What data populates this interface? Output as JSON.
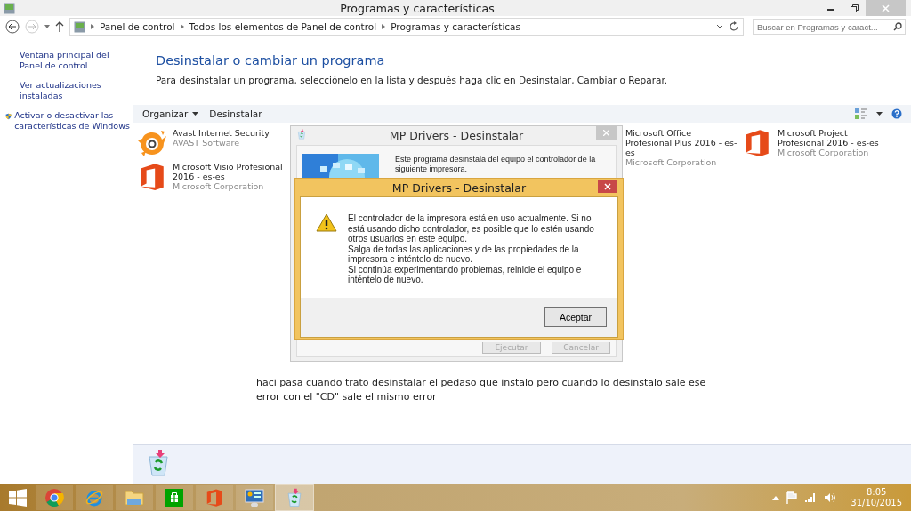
{
  "window": {
    "title": "Programas y características"
  },
  "address_bar": {
    "breadcrumbs": [
      "Panel de control",
      "Todos los elementos de Panel de control",
      "Programas y características"
    ]
  },
  "search": {
    "placeholder": "Buscar en Programas y caract..."
  },
  "sidebar": {
    "links": [
      {
        "label": "Ventana principal del Panel de control",
        "kind": "link"
      },
      {
        "label": "Ver actualizaciones instaladas",
        "kind": "link"
      },
      {
        "label": "Activar o desactivar las características de Windows",
        "kind": "shield"
      }
    ]
  },
  "heading": "Desinstalar o cambiar un programa",
  "description": "Para desinstalar un programa, selecciónelo en la lista y después haga clic en Desinstalar, Cambiar o Reparar.",
  "toolbar": {
    "buttons": [
      {
        "label": "Organizar",
        "kind": "menu"
      },
      {
        "label": "Desinstalar",
        "kind": "plain"
      }
    ]
  },
  "programs": [
    {
      "name": "Avast Internet Security",
      "publisher": "AVAST Software",
      "kind": "avast"
    },
    {
      "name": "Microsoft Office Profesional Plus 2016 - es-es",
      "publisher": "Microsoft Corporation",
      "kind": "covered"
    },
    {
      "name": "Microsoft Project Profesional 2016 - es-es",
      "publisher": "Microsoft Corporation",
      "kind": "office"
    },
    {
      "name": "Microsoft Visio Profesional 2016 - es-es",
      "publisher": "Microsoft Corporation",
      "kind": "office"
    }
  ],
  "caption": "haci pasa cuando trato desinstalar el pedaso que instalo pero cuando lo desinstalo sale ese error con el \"CD\" sale el mismo error",
  "background_dialog": {
    "title": "MP Drivers - Desinstalar",
    "text": "Este programa desinstala del equipo el controlador de la siguiente impresora.",
    "buttons": [
      {
        "label": "Ejecutar",
        "disabled": true
      },
      {
        "label": "Cancelar",
        "disabled": true
      }
    ]
  },
  "alert_dialog": {
    "title": "MP Drivers - Desinstalar",
    "paragraphs": [
      "El controlador de la impresora está en uso actualmente. Si no está usando dicho controlador, es posible que lo estén usando otros usuarios en este equipo.",
      "Salga de todas las aplicaciones y de las propiedades de la impresora e inténtelo de nuevo.",
      "Si continúa experimentando problemas, reinicie el equipo e inténtelo de nuevo."
    ],
    "button": "Aceptar"
  },
  "taskbar": {
    "apps": [
      {
        "kind": "chrome",
        "selected": false
      },
      {
        "kind": "ie",
        "selected": false
      },
      {
        "kind": "explorer",
        "selected": false
      },
      {
        "kind": "store",
        "selected": false
      },
      {
        "kind": "office",
        "selected": false
      },
      {
        "kind": "control-panel",
        "selected": false
      },
      {
        "kind": "uninstaller",
        "selected": true
      }
    ],
    "time": "8:05",
    "date": "31/10/2015"
  }
}
